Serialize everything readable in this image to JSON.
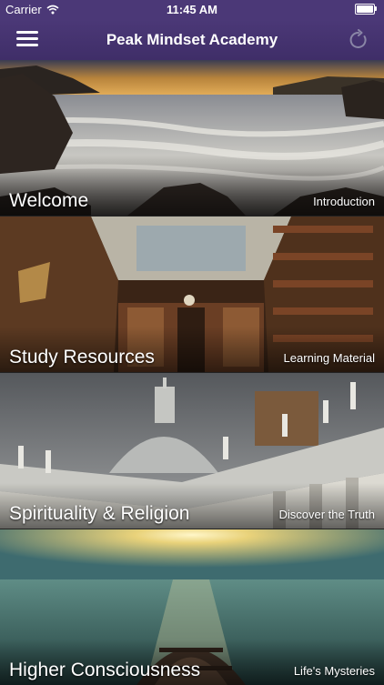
{
  "status_bar": {
    "carrier": "Carrier",
    "time": "11:45 AM",
    "battery_level": 1.0
  },
  "nav": {
    "title": "Peak Mindset Academy"
  },
  "cells": [
    {
      "title": "Welcome",
      "subtitle": "Introduction"
    },
    {
      "title": "Study Resources",
      "subtitle": "Learning Material"
    },
    {
      "title": "Spirituality & Religion",
      "subtitle": "Discover the Truth"
    },
    {
      "title": "Higher Consciousness",
      "subtitle": "Life's Mysteries"
    }
  ],
  "colors": {
    "nav_background": "#4b3877",
    "refresh_icon": "#8a86a6"
  },
  "icons": [
    "wifi-icon",
    "battery-icon",
    "menu-icon",
    "refresh-icon"
  ]
}
